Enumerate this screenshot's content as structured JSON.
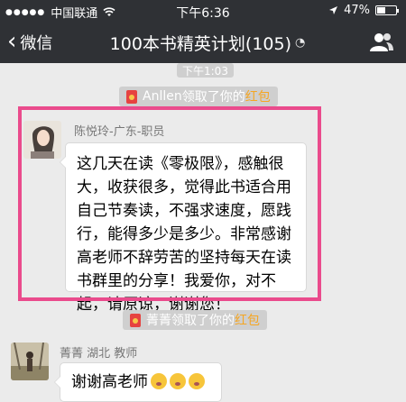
{
  "status_bar": {
    "carrier": "中国联通",
    "time": "下午6:36",
    "battery": "47%",
    "battery_level": 0.47
  },
  "nav": {
    "back_label": "微信",
    "title": "100本书精英计划(105)"
  },
  "chat": {
    "timestamp": "下午1:03",
    "redpack_notice_1": {
      "name": "Anllen",
      "action": "领取了你的",
      "item": "红包"
    },
    "message_1": {
      "sender": "陈悦玲-广东-职员",
      "text": "这几天在读《零极限》，感触很大，收获很多，觉得此书适合用自己节奏读，不强求速度，愿践行，能得多少是多少。非常感谢高老师不辞劳苦的坚持每天在读书群里的分享！我爱你，对不起，请原谅，谢谢您！"
    },
    "redpack_notice_2": {
      "name": "菁菁",
      "action": "领取了你的",
      "item": "红包"
    },
    "message_2": {
      "sender": "菁菁 湖北  教师",
      "text": "谢谢高老师"
    }
  },
  "colors": {
    "nav_bg": "#2f3135",
    "chat_bg": "#ebebeb",
    "highlight_border": "#ea4b8c",
    "redpack_text": "#f5a623"
  }
}
